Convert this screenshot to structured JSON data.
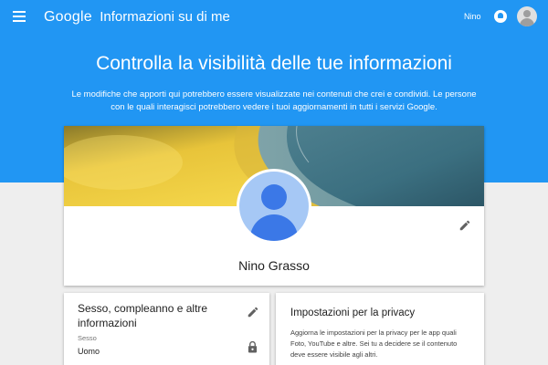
{
  "header": {
    "brand": "Google",
    "app_title": "Informazioni su di me",
    "user_name": "Nino"
  },
  "hero": {
    "headline": "Controlla la visibilità delle tue informazioni",
    "description": "Le modifiche che apporti qui potrebbero essere visualizzate nei contenuti che crei e condividi. Le persone con le quali interagisci potrebbero vedere i tuoi aggiornamenti in tutti i servizi Google."
  },
  "profile": {
    "name": "Nino Grasso"
  },
  "basic_info_card": {
    "title": "Sesso, compleanno e altre informazioni",
    "field_label": "Sesso",
    "field_value": "Uomo"
  },
  "privacy_card": {
    "title": "Impostazioni per la privacy",
    "description": "Aggiorna le impostazioni per la privacy per le app quali Foto, YouTube e altre. Sei tu a decidere se il contenuto deve essere visibile agli altri."
  },
  "icons": {
    "menu": "menu-icon",
    "notifications": "notifications-icon",
    "account": "account-avatar-icon",
    "edit": "pencil-icon",
    "lock": "lock-icon"
  },
  "colors": {
    "primary": "#2196f3",
    "avatar_blue": "#3b78e7",
    "background": "#eeeeee"
  }
}
